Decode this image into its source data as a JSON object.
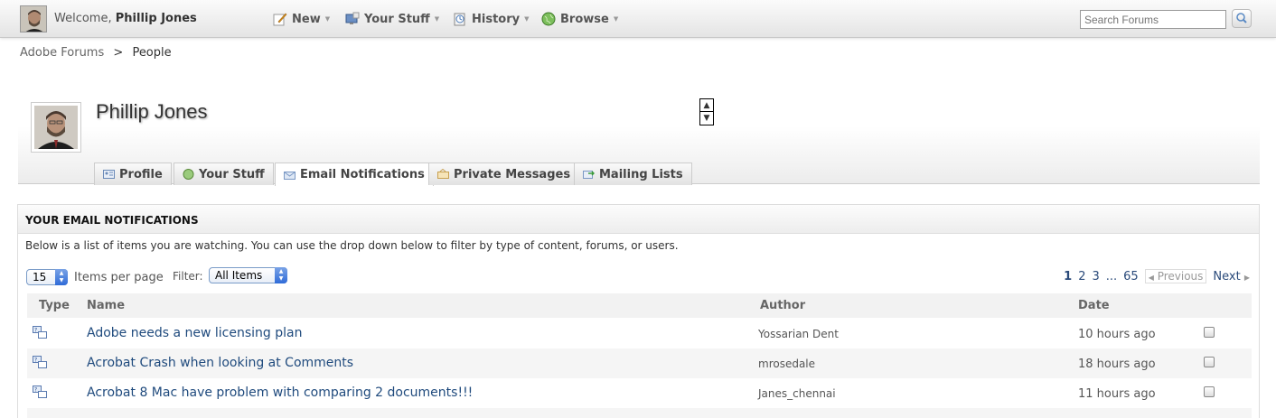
{
  "topbar": {
    "welcome_prefix": "Welcome,",
    "user_name": "Phillip Jones",
    "menus": [
      {
        "label": "New",
        "icon": "pencil-icon"
      },
      {
        "label": "Your Stuff",
        "icon": "monitor-icon"
      },
      {
        "label": "History",
        "icon": "history-icon"
      },
      {
        "label": "Browse",
        "icon": "globe-icon"
      }
    ],
    "search_placeholder": "Search Forums"
  },
  "breadcrumb": {
    "root": "Adobe Forums",
    "separator": ">",
    "current": "People"
  },
  "profile": {
    "name": "Phillip Jones",
    "tabs": [
      {
        "label": "Profile",
        "icon": "profile-card-icon",
        "active": false
      },
      {
        "label": "Your Stuff",
        "icon": "globe-icon",
        "active": false
      },
      {
        "label": "Email Notifications",
        "icon": "envelope-icon",
        "active": true
      },
      {
        "label": "Private Messages",
        "icon": "message-icon",
        "active": false
      },
      {
        "label": "Mailing Lists",
        "icon": "mail-arrow-icon",
        "active": false
      }
    ]
  },
  "notifications": {
    "title": "YOUR EMAIL NOTIFICATIONS",
    "description": "Below is a list of items you are watching. You can use the drop down below to filter by type of content, forums, or users.",
    "per_page_value": "15",
    "per_page_label": "Items per page",
    "filter_label": "Filter:",
    "filter_value": "All Items",
    "pagination": {
      "pages": [
        "1",
        "2",
        "3"
      ],
      "ellipsis": "...",
      "last": "65",
      "previous": "Previous",
      "next": "Next",
      "current": "1"
    },
    "columns": {
      "type": "Type",
      "name": "Name",
      "author": "Author",
      "date": "Date"
    },
    "rows": [
      {
        "name": "Adobe needs a new licensing plan",
        "author": "Yossarian Dent",
        "date": "10 hours ago"
      },
      {
        "name": "Acrobat Crash when looking at Comments",
        "author": "mrosedale",
        "date": "18 hours ago"
      },
      {
        "name": "Acrobat 8 Mac have problem with comparing 2 documents!!!",
        "author": "Janes_chennai",
        "date": "11 hours ago"
      }
    ]
  },
  "colors": {
    "link": "#1f4a7d",
    "accent_select": "#2f6bd8"
  }
}
